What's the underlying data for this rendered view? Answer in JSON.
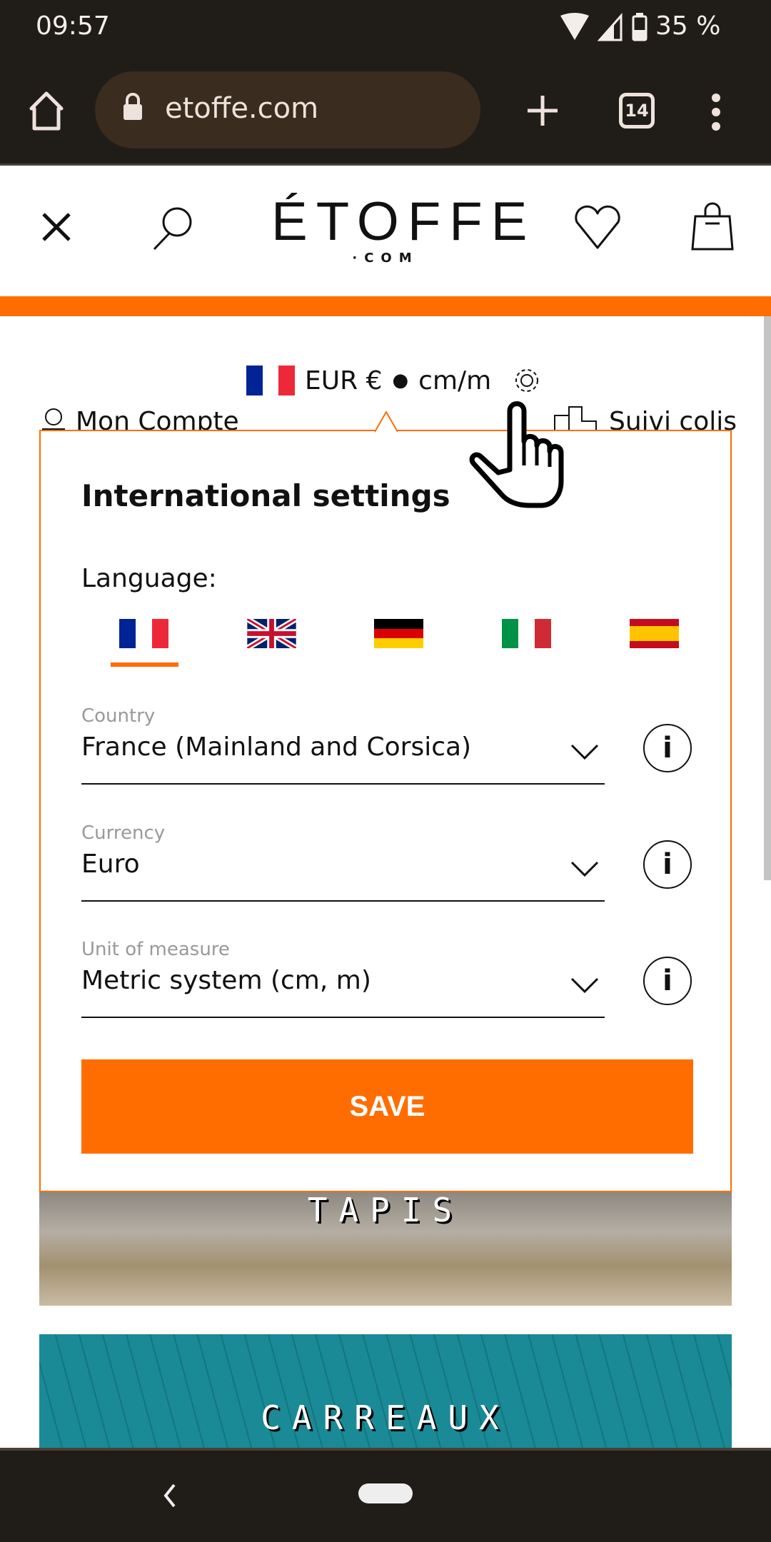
{
  "status": {
    "time": "09:57",
    "battery": "35 %"
  },
  "browser": {
    "url": "etoffe.com",
    "tab_count": "14"
  },
  "header": {
    "logo": "ÉTOFFE",
    "logo_sub": "·COM"
  },
  "settings_bar": {
    "currency": "EUR €",
    "separator": "●",
    "unit": "cm/m",
    "account": "Mon Compte",
    "tracking": "Suivi colis"
  },
  "popup": {
    "title": "International settings",
    "language_label": "Language:",
    "languages": [
      "French",
      "English",
      "German",
      "Italian",
      "Spanish"
    ],
    "selected_language": "French",
    "fields": [
      {
        "label": "Country",
        "value": "France (Mainland and Corsica)"
      },
      {
        "label": "Currency",
        "value": "Euro"
      },
      {
        "label": "Unit of measure",
        "value": "Metric system (cm, m)"
      }
    ],
    "info_symbol": "i",
    "save_label": "SAVE"
  },
  "banners": [
    {
      "label": "TAPIS"
    },
    {
      "label": "CARREAUX"
    }
  ],
  "colors": {
    "accent": "#ff6d00",
    "chrome": "#201d19"
  }
}
